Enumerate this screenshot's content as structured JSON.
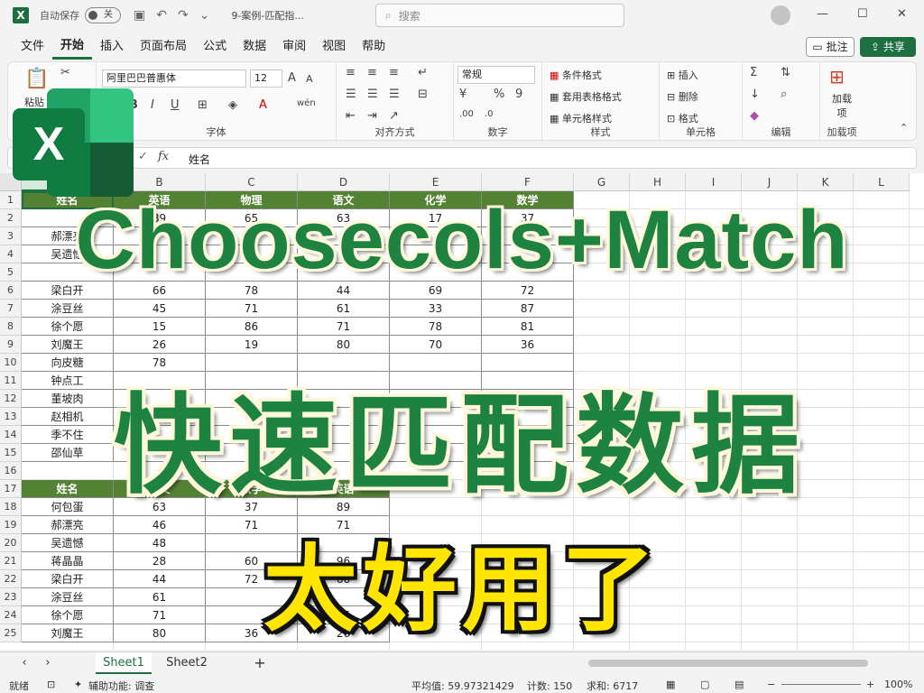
{
  "titlebar": {
    "autosave_label": "自动保存",
    "autosave_state": "关",
    "filename": "9-案例-匹配指...",
    "search_placeholder": "搜索"
  },
  "menu": {
    "items": [
      "文件",
      "开始",
      "插入",
      "页面布局",
      "公式",
      "数据",
      "审阅",
      "视图",
      "帮助"
    ],
    "comment_label": "批注",
    "share_label": "共享"
  },
  "ribbon": {
    "paste_label": "粘贴",
    "font_name": "阿里巴巴普惠体",
    "font_size": "12",
    "font_group": "字体",
    "align_group": "对齐方式",
    "number_format": "常规",
    "number_group": "数字",
    "cond_format": "条件格式",
    "table_format": "套用表格格式",
    "cell_style": "单元格样式",
    "style_group": "样式",
    "insert": "插入",
    "delete": "删除",
    "format": "格式",
    "cells_group": "单元格",
    "edit_group": "编辑",
    "addin_label": "加载项",
    "addin_group": "加载项"
  },
  "formula": {
    "content": "姓名"
  },
  "columns": [
    "A",
    "B",
    "C",
    "D",
    "E",
    "F",
    "G",
    "H",
    "I",
    "J",
    "K",
    "L"
  ],
  "rows": [
    "1",
    "2",
    "3",
    "4",
    "5",
    "6",
    "7",
    "8",
    "9",
    "10",
    "11",
    "12",
    "13",
    "14",
    "15",
    "16",
    "17",
    "18",
    "19",
    "20",
    "21",
    "22",
    "23",
    "24",
    "25"
  ],
  "table1": {
    "headers": [
      "姓名",
      "英语",
      "物理",
      "语文",
      "化学",
      "数学"
    ],
    "rows": [
      [
        "",
        "89",
        "65",
        "63",
        "17",
        "37"
      ],
      [
        "郝漂亮",
        "",
        "",
        "",
        "",
        ""
      ],
      [
        "吴遗憾",
        "",
        "",
        "",
        "",
        ""
      ],
      [
        "",
        "",
        "",
        "",
        "",
        ""
      ],
      [
        "梁白开",
        "66",
        "78",
        "44",
        "69",
        "72"
      ],
      [
        "涂豆丝",
        "45",
        "71",
        "61",
        "33",
        "87"
      ],
      [
        "徐个愿",
        "15",
        "86",
        "71",
        "78",
        "81"
      ],
      [
        "刘魔王",
        "26",
        "19",
        "80",
        "70",
        "36"
      ],
      [
        "向皮糖",
        "78",
        "",
        "",
        "",
        ""
      ],
      [
        "钟点工",
        "",
        "",
        "",
        "",
        ""
      ],
      [
        "董坡肉",
        "",
        "",
        "",
        "",
        ""
      ],
      [
        "赵相机",
        "",
        "",
        "",
        "",
        ""
      ],
      [
        "季不住",
        "",
        "",
        "",
        "",
        ""
      ],
      [
        "邵仙草",
        "",
        "",
        "",
        "",
        ""
      ]
    ]
  },
  "table2": {
    "headers": [
      "姓名",
      "语文",
      "数学",
      "英语"
    ],
    "rows": [
      [
        "何包蛋",
        "63",
        "37",
        "89"
      ],
      [
        "郝漂亮",
        "46",
        "71",
        "71"
      ],
      [
        "吴遗憾",
        "48",
        "",
        ""
      ],
      [
        "蒋晶晶",
        "28",
        "60",
        "96"
      ],
      [
        "梁白开",
        "44",
        "72",
        "66"
      ],
      [
        "涂豆丝",
        "61",
        "",
        ""
      ],
      [
        "徐个愿",
        "71",
        "",
        "15"
      ],
      [
        "刘魔王",
        "80",
        "36",
        "26"
      ]
    ]
  },
  "overlay": {
    "line1": "Choosecols+Match",
    "line2": "快速匹配数据",
    "line3": "太好用了"
  },
  "tabs": {
    "sheet1": "Sheet1",
    "sheet2": "Sheet2",
    "add": "+"
  },
  "status": {
    "ready": "就绪",
    "accessibility": "辅助功能: 调查",
    "average": "平均值: 59.97321429",
    "count": "计数: 150",
    "sum": "求和: 6717",
    "zoom": "100%"
  },
  "colors": {
    "brand": "#1d6f42",
    "header_fill": "#548235",
    "overlay_green": "#1e8241",
    "overlay_yellow": "#ffe500"
  }
}
